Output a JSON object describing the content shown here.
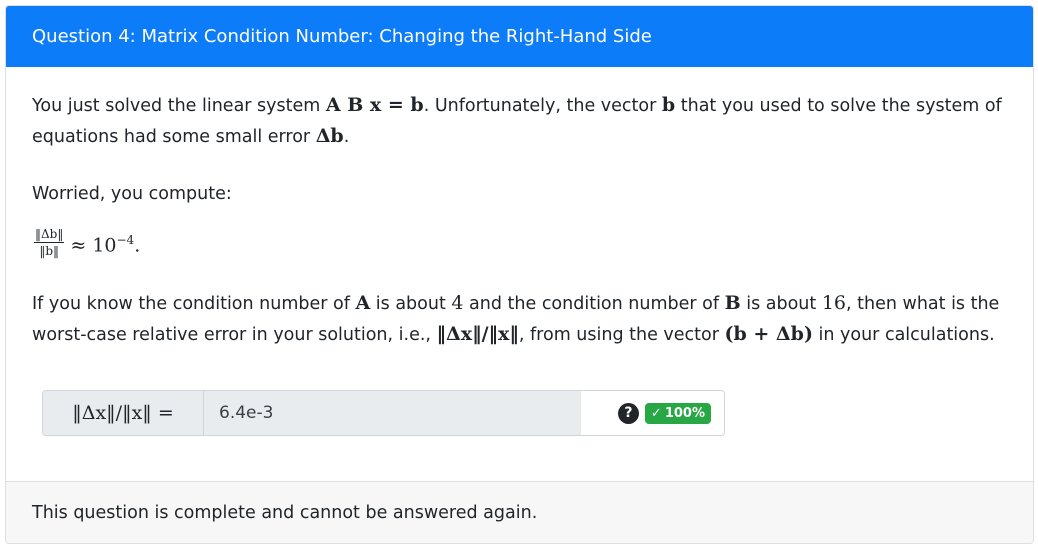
{
  "header": {
    "title": "Question 4: Matrix Condition Number: Changing the Right-Hand Side"
  },
  "body": {
    "p1_text_a": "You just solved the linear system ",
    "p1_math_a": "A B x = b",
    "p1_text_b": ". Unfortunately, the vector ",
    "p1_math_b": "b",
    "p1_text_c": " that you used to solve the system of equations had some small error ",
    "p1_math_c": "Δb",
    "p1_text_d": ".",
    "p2_text": "Worried, you compute:",
    "eq_num": "‖Δb‖",
    "eq_den": "‖b‖",
    "eq_rhs": "≈ 10",
    "eq_exp": "−4",
    "eq_end": ".",
    "p3_text_a": "If you know the condition number of ",
    "p3_math_a": "A",
    "p3_text_b": " is about ",
    "p3_math_b": "4",
    "p3_text_c": " and the condition number of ",
    "p3_math_c": "B",
    "p3_text_d": " is about ",
    "p3_math_d": "16",
    "p3_text_e": ", then what is the worst-case relative error in your solution, i.e., ",
    "p3_math_e": "‖Δx‖/‖x‖",
    "p3_text_f": ", from using the vector ",
    "p3_math_f": "(b + Δb)",
    "p3_text_g": " in your calculations."
  },
  "answer": {
    "label": "‖Δx‖/‖x‖ =",
    "value": "6.4e-3",
    "help_icon": "question-circle-icon",
    "help_glyph": "?",
    "badge_check": "✓",
    "badge_score": "100%",
    "badge_color": "#28a745"
  },
  "footer": {
    "text": "This question is complete and cannot be answered again."
  },
  "colors": {
    "header_bg": "#0d7cf8",
    "footer_bg": "#f7f7f7",
    "input_bg": "#e9ecef"
  }
}
